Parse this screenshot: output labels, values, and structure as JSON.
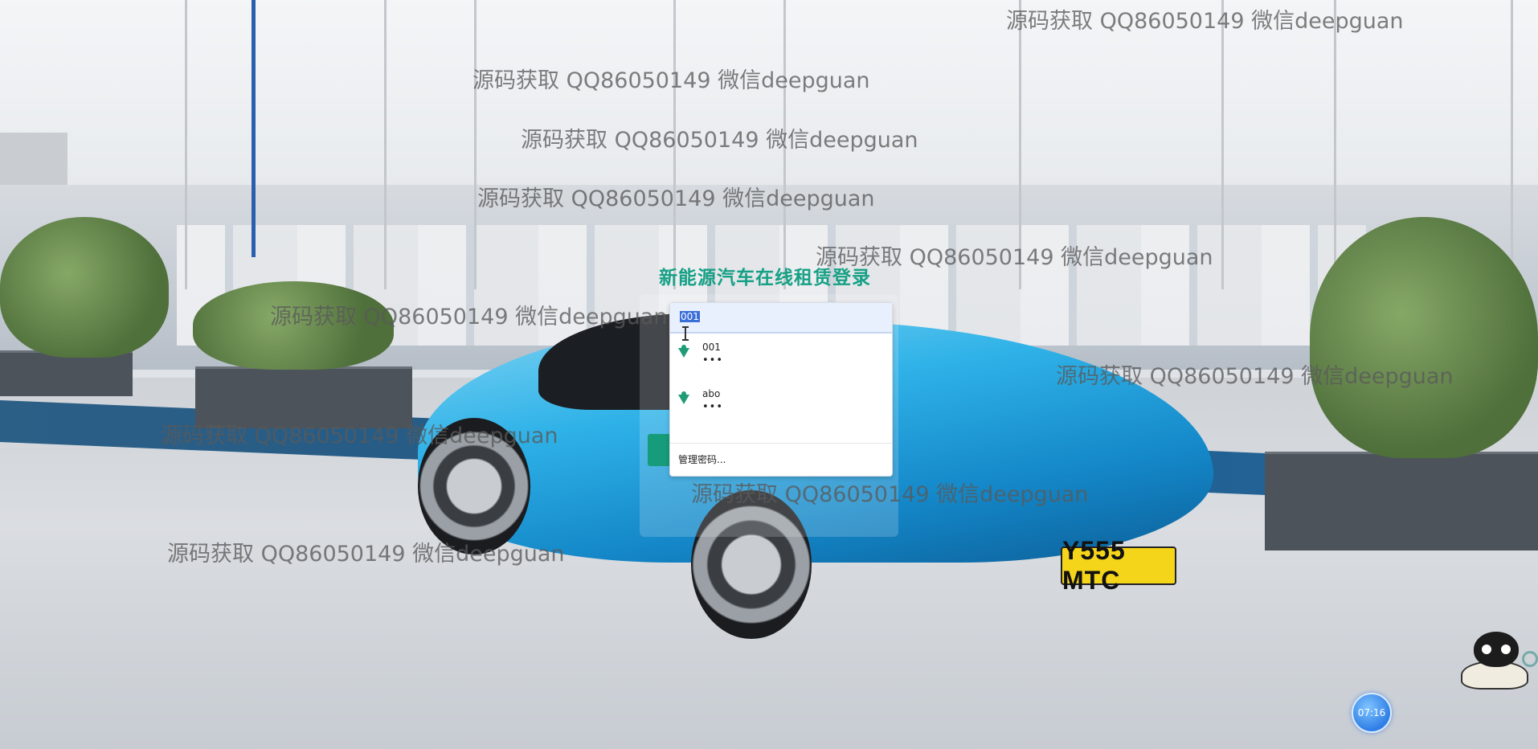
{
  "page": {
    "login_title": "新能源汽车在线租赁登录"
  },
  "autocomplete": {
    "input_value": "001",
    "items": [
      {
        "username": "001",
        "password_mask": "•••"
      },
      {
        "username": "abo",
        "password_mask": "•••"
      }
    ],
    "manage_label": "管理密码..."
  },
  "watermark_text": "源码获取 QQ86050149 微信deepguan",
  "car": {
    "plate": "Y555 MTC"
  },
  "clock": {
    "time": "07:16"
  },
  "colors": {
    "accent": "#16a085",
    "autofill_bg": "#e8f0fe",
    "clock_blue": "#2f7ee6"
  },
  "icons": {
    "credential_icon": "key-icon",
    "clock_icon": "clock-bubble-icon",
    "mascot_icon": "cat-mascot-icon"
  }
}
